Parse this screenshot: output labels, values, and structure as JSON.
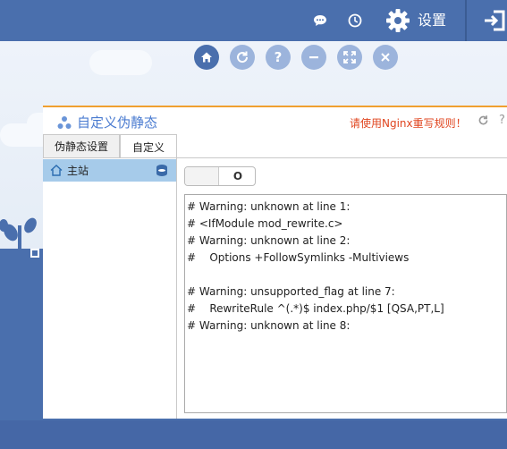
{
  "topbar": {
    "icons": [
      "chat-icon",
      "clock-icon",
      "gear-icon",
      "exit-icon"
    ],
    "settings_label": "设置"
  },
  "toolbar": {
    "buttons": [
      "home-icon",
      "refresh-icon",
      "help-icon",
      "minimize-icon",
      "fullscreen-icon",
      "close-icon"
    ]
  },
  "panel": {
    "title": "自定义伪静态",
    "warning": "请使用Nginx重写规则！",
    "help": "?",
    "tabs": [
      {
        "label": "伪静态设置",
        "active": false
      },
      {
        "label": "自定义",
        "active": true
      }
    ],
    "sidebar": {
      "items": [
        {
          "label": "主站",
          "selected": true
        }
      ]
    },
    "toggle": {
      "label": "O"
    },
    "editor": {
      "lines": [
        "# Warning: unknown at line 1:",
        "# <IfModule mod_rewrite.c>",
        "# Warning: unknown at line 2:",
        "#    Options +FollowSymlinks -Multiviews",
        "",
        "# Warning: unsupported_flag at line 7:",
        "#    RewriteRule ^(.*)$ index.php/$1 [QSA,PT,L]",
        "# Warning: unknown at line 8:"
      ]
    }
  },
  "colors": {
    "primary": "#4a6fad",
    "accent_orange": "#f0a030",
    "warning_red": "#e0451f",
    "selected_row": "#a6cbea",
    "title_blue": "#4a7bd0"
  }
}
